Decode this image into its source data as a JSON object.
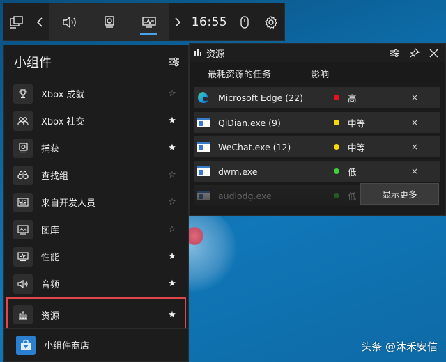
{
  "topbar": {
    "time": "16:55",
    "buttons": [
      "widget-menu-icon",
      "chevron-left-icon",
      "audio-icon",
      "capture-icon",
      "performance-icon",
      "chevron-right-icon",
      "mouse-icon",
      "gear-icon"
    ]
  },
  "menu": {
    "title": "小组件",
    "items": [
      {
        "label": "Xbox 成就",
        "icon": "trophy-icon",
        "favorite": false
      },
      {
        "label": "Xbox 社交",
        "icon": "people-icon",
        "favorite": true
      },
      {
        "label": "捕获",
        "icon": "capture-icon",
        "favorite": true
      },
      {
        "label": "查找组",
        "icon": "binoculars-icon",
        "favorite": false
      },
      {
        "label": "来自开发人员",
        "icon": "developer-icon",
        "favorite": false
      },
      {
        "label": "图库",
        "icon": "gallery-icon",
        "favorite": false
      },
      {
        "label": "性能",
        "icon": "performance-icon",
        "favorite": true
      },
      {
        "label": "音频",
        "icon": "audio-icon",
        "favorite": true
      },
      {
        "label": "资源",
        "icon": "resources-icon",
        "favorite": true,
        "selected": true
      }
    ],
    "store_label": "小组件商店",
    "star_on": "★",
    "star_off": "☆"
  },
  "resources": {
    "title": "资源",
    "col_task": "最耗资源的任务",
    "col_impact": "影响",
    "rows": [
      {
        "name": "Microsoft Edge (22)",
        "impact": "高",
        "color": "#e81123"
      },
      {
        "name": "QiDian.exe (9)",
        "impact": "中等",
        "color": "#f5d90a"
      },
      {
        "name": "WeChat.exe (12)",
        "impact": "中等",
        "color": "#f5d90a"
      },
      {
        "name": "dwm.exe",
        "impact": "低",
        "color": "#3fd13a"
      },
      {
        "name": "audiodg.exe",
        "impact": "低",
        "color": "#3fd13a"
      }
    ],
    "show_more": "显示更多",
    "close_glyph": "×"
  },
  "watermark": "头条 @沐禾安信"
}
